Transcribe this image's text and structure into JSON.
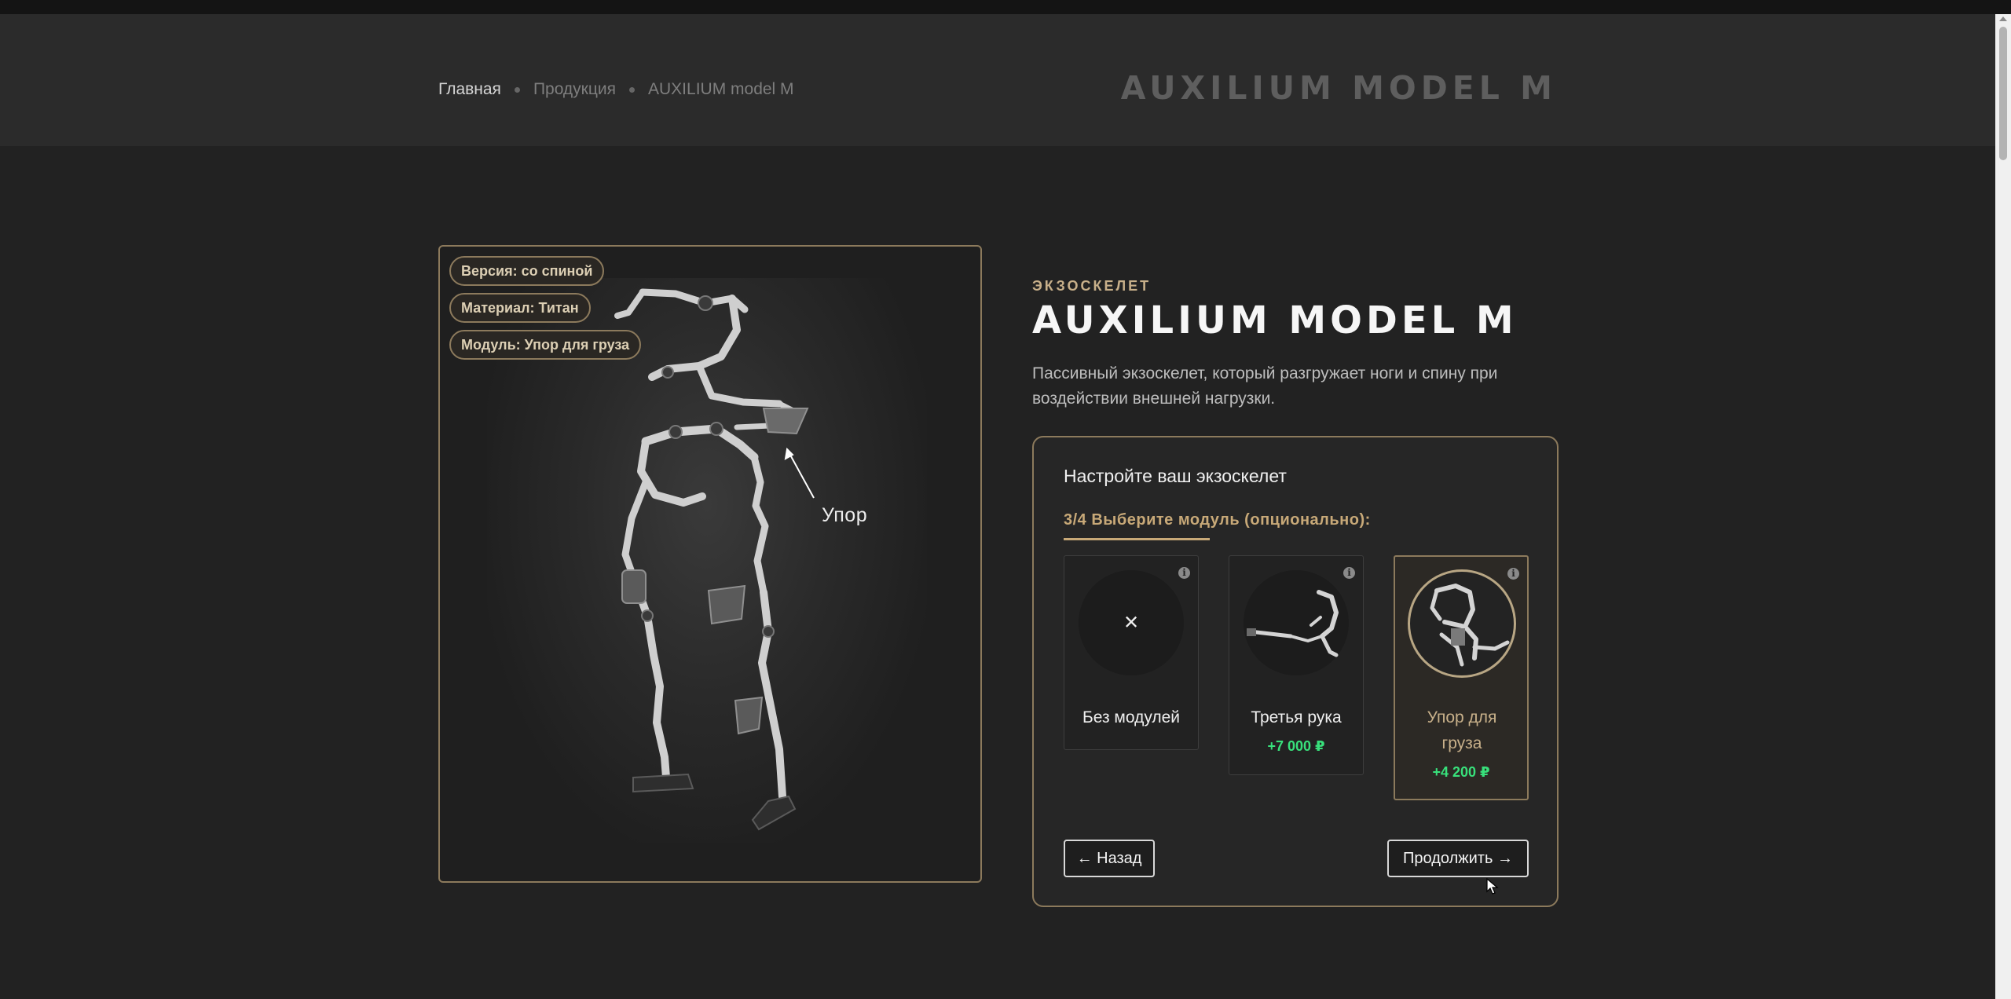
{
  "breadcrumb": {
    "home": "Главная",
    "products": "Продукция",
    "current": "AUXILIUM model M"
  },
  "header": {
    "title": "AUXILIUM MODEL M"
  },
  "image_panel": {
    "tags": [
      "Версия: со спиной",
      "Материал: Титан",
      "Модуль: Упор для груза"
    ],
    "callout": "Упор"
  },
  "product": {
    "eyebrow": "ЭКЗОСКЕЛЕТ",
    "title": "AUXILIUM MODEL M",
    "description": "Пассивный экзоскелет, который разгружает ноги и спину при воздействии внешней нагрузки."
  },
  "configurator": {
    "title": "Настройте ваш экзоскелет",
    "step": "3/4 Выберите модуль (опционально):",
    "options": [
      {
        "label": "Без модулей",
        "price": "",
        "selected": false,
        "icon": "close-icon"
      },
      {
        "label": "Третья рука",
        "price": "+7 000 ₽",
        "selected": false,
        "icon": "third-arm-image"
      },
      {
        "label": "Упор для груза",
        "price": "+4 200 ₽",
        "selected": true,
        "icon": "load-support-image"
      }
    ],
    "back_label": "← Назад",
    "continue_label": "Продолжить →",
    "info_glyph": "i",
    "none_glyph": "✕"
  },
  "colors": {
    "accent": "#c8a978",
    "border_gold": "#8c7a5c",
    "price_green": "#38e07b",
    "background": "#222222",
    "header_bg": "#2b2b2b"
  }
}
